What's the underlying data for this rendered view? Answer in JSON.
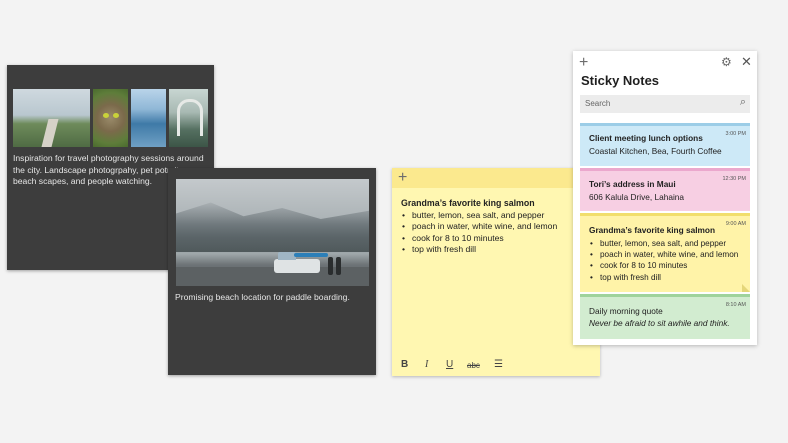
{
  "notes": {
    "photos": {
      "caption": "Inspiration for travel photography sessions around the city. Landscape photogrpahy, pet potraits, beach scapes, and people watching."
    },
    "beach": {
      "caption": "Promising beach location for paddle boarding."
    },
    "yellow": {
      "title": "Grandma’s favorite king salmon",
      "items": [
        "butter, lemon, sea salt, and pepper",
        "poach in water, white wine, and lemon",
        "cook for 8 to 10 minutes",
        "top with fresh dill"
      ],
      "more": "···",
      "toolbar": {
        "bold": "B",
        "italic": "I",
        "underline": "U",
        "strike": "abc",
        "list": "☰"
      }
    }
  },
  "panel": {
    "title": "Sticky Notes",
    "search_placeholder": "Search",
    "cards": [
      {
        "time": "3:00 PM",
        "title": "Client meeting lunch options",
        "line": "Coastal Kitchen, Bea, Fourth Coffee",
        "color": "#cde9f7"
      },
      {
        "time": "12:30 PM",
        "title": "Tori’s address in Maui",
        "line": "606 Kalula Drive, Lahaina",
        "color": "#f7cfe3"
      },
      {
        "time": "9:00 AM",
        "title": "Grandma’s favorite king salmon",
        "items": [
          "butter, lemon, sea salt, and pepper",
          "poach in water, white wine, and lemon",
          "cook for 8 to 10 minutes",
          "top with fresh dill"
        ],
        "color": "#fff3a8"
      },
      {
        "time": "8:10 AM",
        "title": "Daily morning quote",
        "line": "Never be afraid to sit awhile and think.",
        "color": "#d2ecd0"
      }
    ]
  },
  "icons": {
    "plus": "+",
    "gear": "⚙",
    "close": "✕",
    "search": "⌕"
  }
}
